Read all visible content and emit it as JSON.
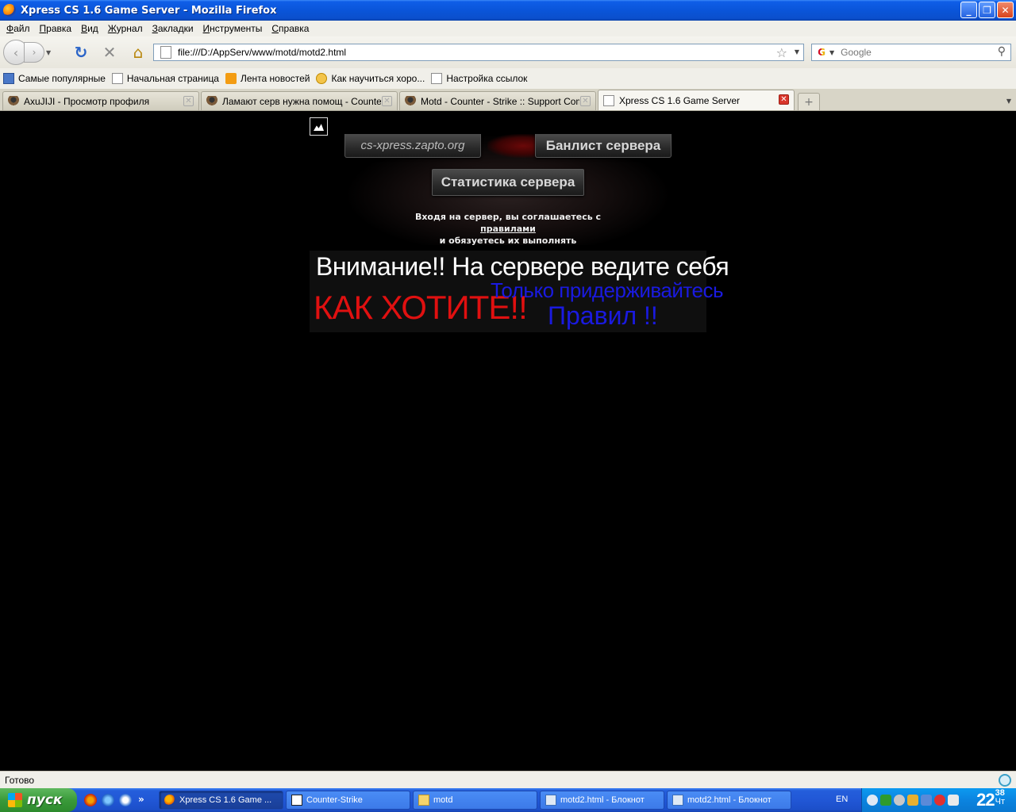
{
  "window": {
    "title": "Xpress CS 1.6 Game Server - Mozilla Firefox",
    "buttons": {
      "minimize": "_",
      "maximize": "❐",
      "close": "✕"
    }
  },
  "menu": [
    "Файл",
    "Правка",
    "Вид",
    "Журнал",
    "Закладки",
    "Инструменты",
    "Справка"
  ],
  "navbar": {
    "url": "file:///D:/AppServ/www/motd/motd2.html",
    "search_placeholder": "Google"
  },
  "bookmarks": [
    {
      "label": "Самые популярные",
      "icon": "popular-icon"
    },
    {
      "label": "Начальная страница",
      "icon": "page-icon"
    },
    {
      "label": "Лента новостей",
      "icon": "rss-icon"
    },
    {
      "label": "Как научиться хоро...",
      "icon": "help-icon"
    },
    {
      "label": "Настройка ссылок",
      "icon": "page-icon"
    }
  ],
  "tabs": [
    {
      "label": "AxuJIJI - Просмотр профиля",
      "active": false
    },
    {
      "label": "Ламают серв нужна помощ - Counter ...",
      "active": false
    },
    {
      "label": "Motd - Counter - Strike :: Support Com...",
      "active": false
    },
    {
      "label": "Xpress CS 1.6 Game Server",
      "active": true
    }
  ],
  "page": {
    "site_button": "cs-xpress.zapto.org",
    "banlist_button": "Банлист сервера",
    "stats_button": "Статистика сервера",
    "rules_line1_pre": "Входя на сервер, вы соглашаетесь с ",
    "rules_link": "правилами",
    "rules_line2": "и обязуетесь их выполнять",
    "notice_line1": "Внимание!! На сервере ведите себя",
    "notice_line2": "КАК ХОТИТЕ!!",
    "notice_line3": "Только придерживайтесь",
    "notice_line4": "Правил !!",
    "colors": {
      "white": "#ffffff",
      "red": "#e01010",
      "blue": "#1a1ae0"
    }
  },
  "status": {
    "text": "Готово"
  },
  "taskbar": {
    "start_label": "пуск",
    "quick_more": "»",
    "tasks": [
      {
        "label": "Xpress CS 1.6 Game ...",
        "icon": "firefox-icon",
        "active": true
      },
      {
        "label": "Counter-Strike",
        "icon": "counter-strike-icon",
        "active": false
      },
      {
        "label": "motd",
        "icon": "folder-icon",
        "active": false
      },
      {
        "label": "motd2.html - Блокнот",
        "icon": "notepad-icon",
        "active": false
      },
      {
        "label": "motd2.html - Блокнот",
        "icon": "notepad-icon",
        "active": false
      }
    ],
    "lang": "EN",
    "clock_hour": "22",
    "clock_min": "38",
    "clock_day": "Чт"
  }
}
